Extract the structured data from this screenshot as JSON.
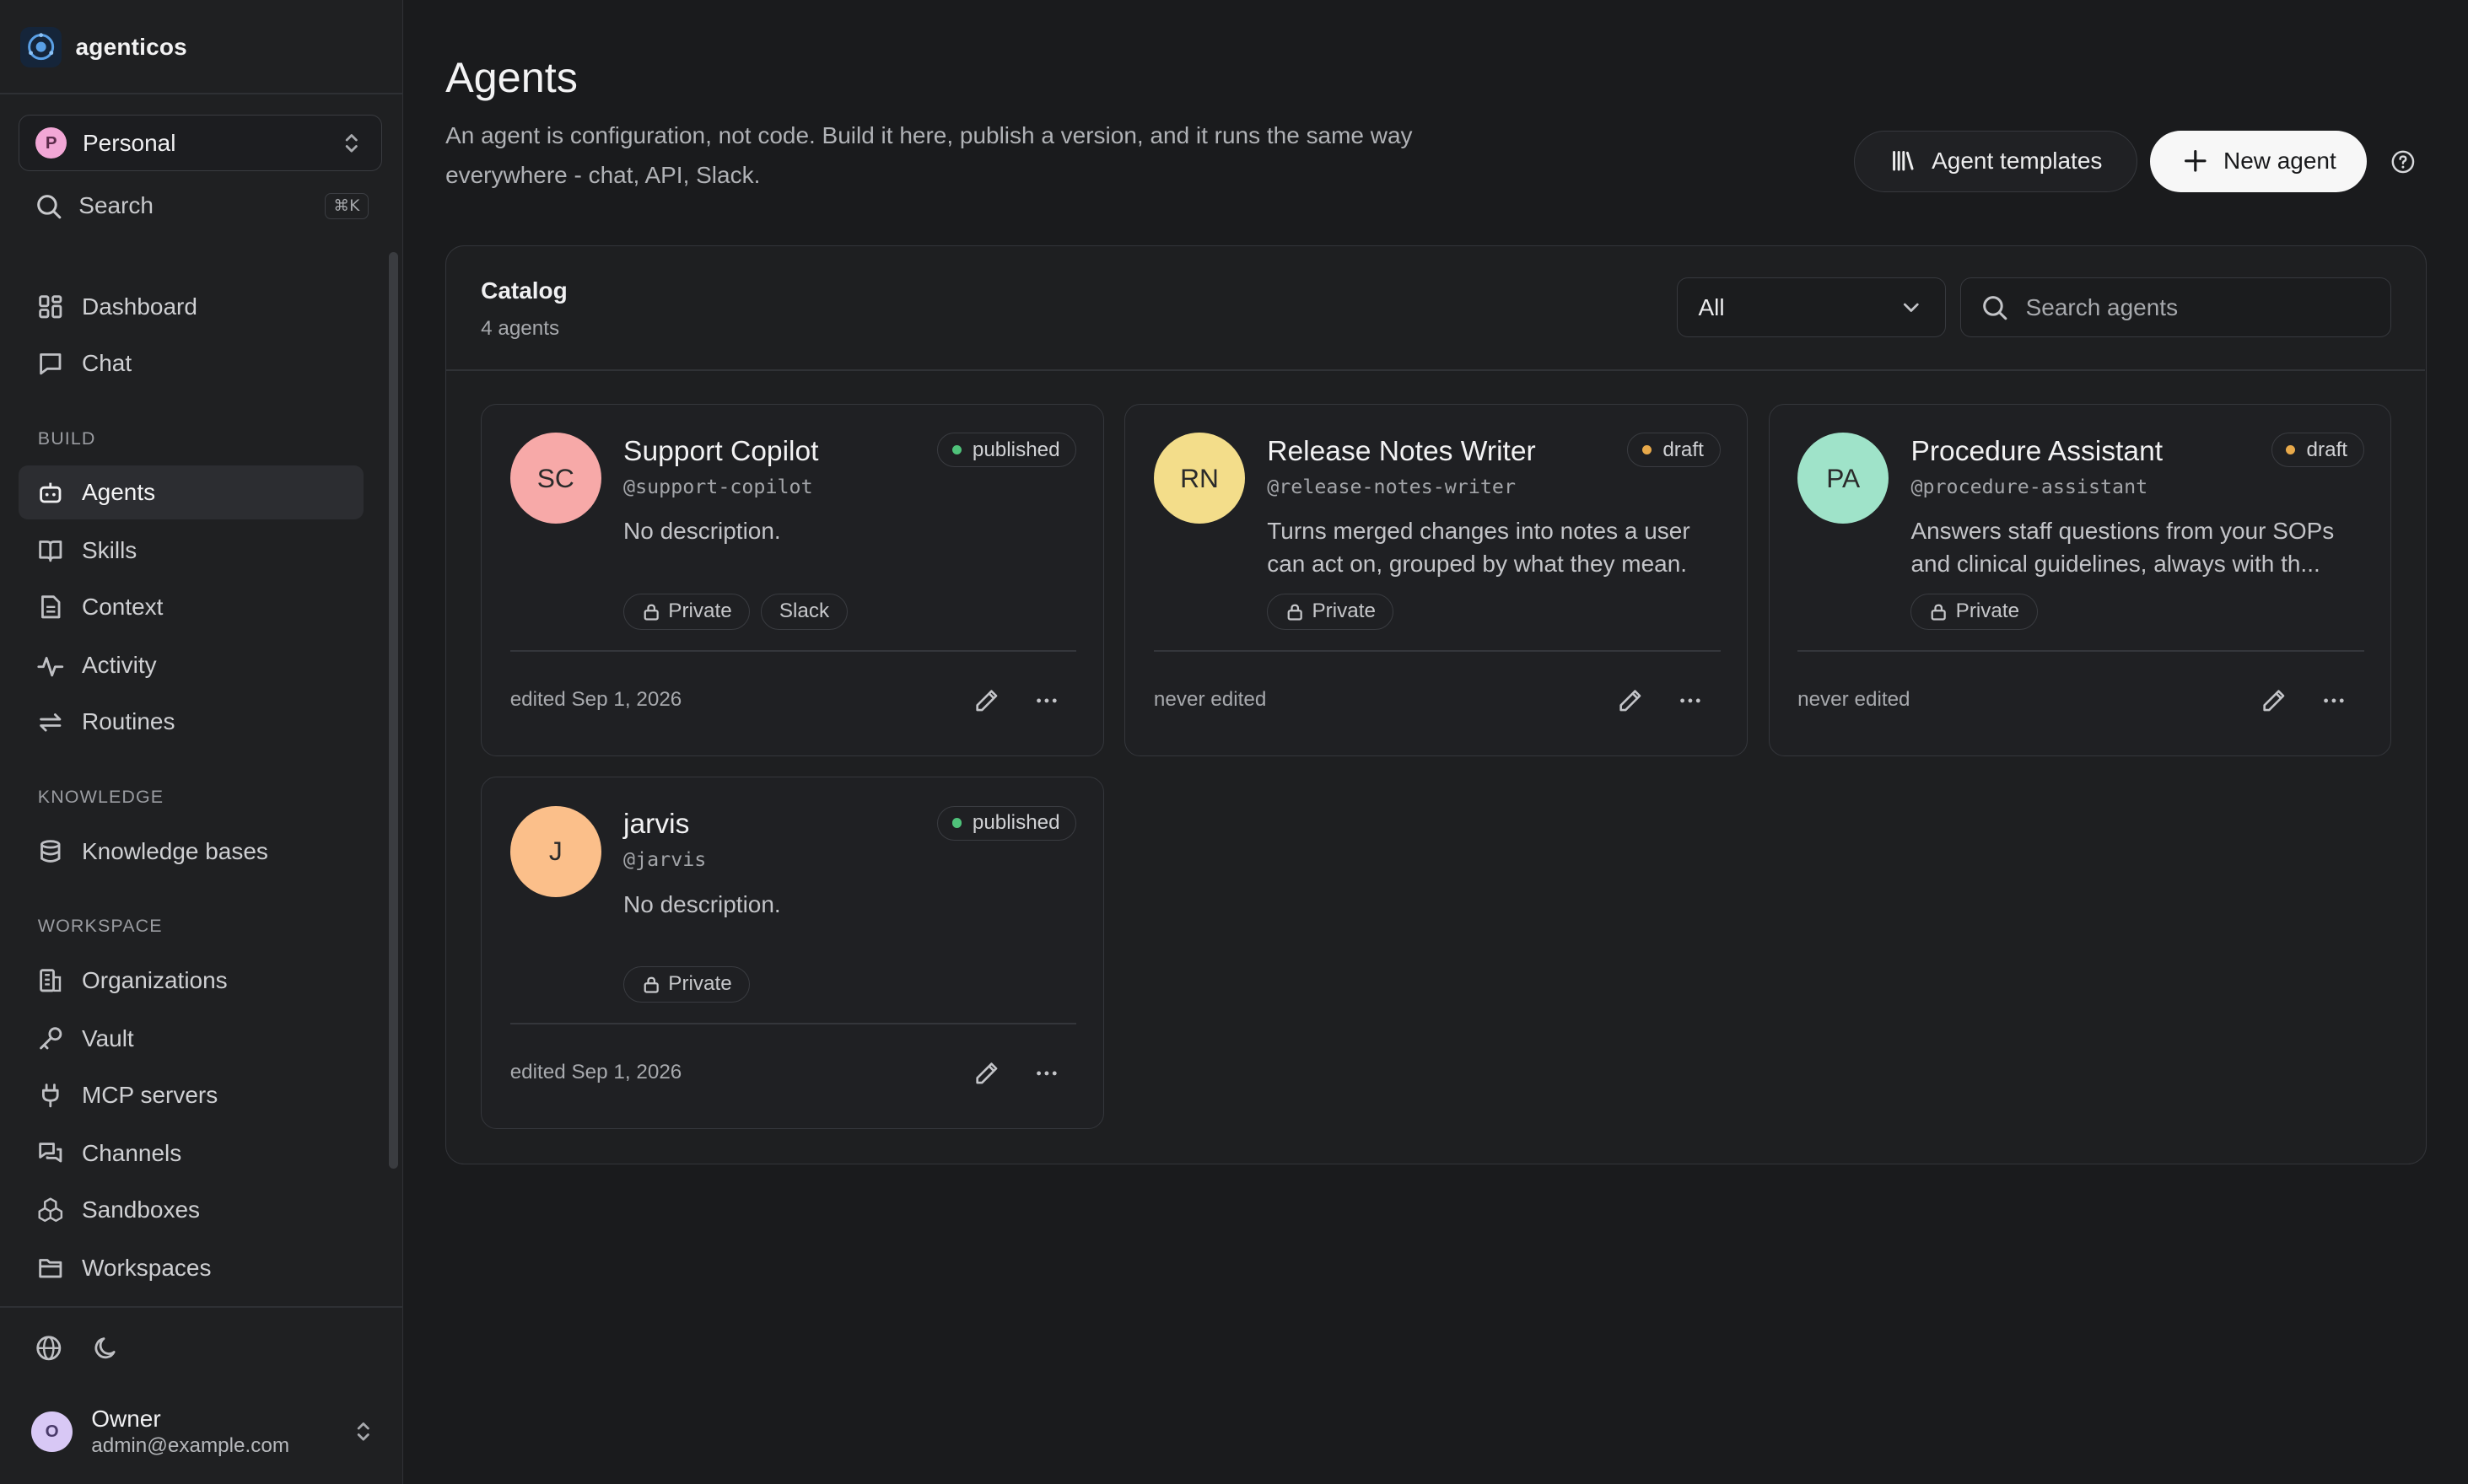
{
  "brand": {
    "name": "agenticos"
  },
  "workspace": {
    "avatar": "P",
    "name": "Personal"
  },
  "search": {
    "label": "Search",
    "shortcut": "⌘K"
  },
  "nav": {
    "top": [
      {
        "label": "Dashboard",
        "icon": "dashboard-icon"
      },
      {
        "label": "Chat",
        "icon": "chat-icon"
      }
    ],
    "build_label": "BUILD",
    "build": [
      {
        "label": "Agents",
        "icon": "robot-icon",
        "active": true
      },
      {
        "label": "Skills",
        "icon": "book-icon"
      },
      {
        "label": "Context",
        "icon": "document-icon"
      },
      {
        "label": "Activity",
        "icon": "activity-icon"
      },
      {
        "label": "Routines",
        "icon": "repeat-icon"
      }
    ],
    "knowledge_label": "KNOWLEDGE",
    "knowledge": [
      {
        "label": "Knowledge bases",
        "icon": "database-icon"
      }
    ],
    "workspace_label": "WORKSPACE",
    "workspace": [
      {
        "label": "Organizations",
        "icon": "building-icon"
      },
      {
        "label": "Vault",
        "icon": "key-icon"
      },
      {
        "label": "MCP servers",
        "icon": "plug-icon"
      },
      {
        "label": "Channels",
        "icon": "messages-icon"
      },
      {
        "label": "Sandboxes",
        "icon": "boxes-icon"
      },
      {
        "label": "Workspaces",
        "icon": "folder-icon"
      }
    ]
  },
  "user": {
    "avatar": "O",
    "name": "Owner",
    "email": "admin@example.com"
  },
  "header": {
    "title": "Agents",
    "subtitle": "An agent is configuration, not code. Build it here, publish a version, and it runs the same way everywhere - chat, API, Slack.",
    "templates_label": "Agent templates",
    "new_label": "New agent"
  },
  "catalog": {
    "title": "Catalog",
    "count": "4 agents",
    "filter_value": "All",
    "search_placeholder": "Search agents",
    "agents": [
      {
        "initials": "SC",
        "avatar_color": "#f7a9a8",
        "name": "Support Copilot",
        "handle": "@support-copilot",
        "status": "published",
        "status_color": "#4fc27a",
        "description": "No description.",
        "tags": [
          "Private",
          "Slack"
        ],
        "edited": "edited Sep 1, 2026"
      },
      {
        "initials": "RN",
        "avatar_color": "#f3dd8a",
        "name": "Release Notes Writer",
        "handle": "@release-notes-writer",
        "status": "draft",
        "status_color": "#e8a94a",
        "description": "Turns merged changes into notes a user can act on, grouped by what they mean.",
        "tags": [
          "Private"
        ],
        "edited": "never edited"
      },
      {
        "initials": "PA",
        "avatar_color": "#9fe3c9",
        "name": "Procedure Assistant",
        "handle": "@procedure-assistant",
        "status": "draft",
        "status_color": "#e8a94a",
        "description": "Answers staff questions from your SOPs and clinical guidelines, always with th...",
        "tags": [
          "Private"
        ],
        "edited": "never edited"
      },
      {
        "initials": "J",
        "avatar_color": "#fbbf8a",
        "name": "jarvis",
        "handle": "@jarvis",
        "status": "published",
        "status_color": "#4fc27a",
        "description": "No description.",
        "tags": [
          "Private"
        ],
        "edited": "edited Sep 1, 2026"
      }
    ]
  }
}
